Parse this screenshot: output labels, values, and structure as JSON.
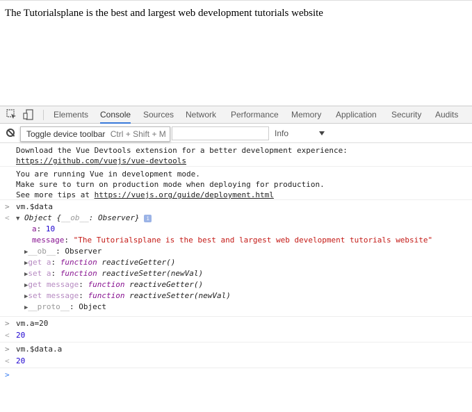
{
  "page": {
    "text": "The Tutorialsplane is the best and largest web development tutorials website"
  },
  "devtools": {
    "tabs": [
      "Elements",
      "Console",
      "Sources",
      "Network",
      "Performance",
      "Memory",
      "Application",
      "Security",
      "Audits"
    ],
    "active_tab": "Console",
    "tooltip": {
      "label": "Toggle device toolbar",
      "shortcut": "Ctrl + Shift + M"
    },
    "filter_placeholder": "",
    "level": "Info",
    "icons": [
      "inspect-icon",
      "device-icon",
      "clear-console-icon",
      "dropdown-arrow-icon"
    ],
    "colors": {
      "active_tab_underline": "#3879d9",
      "string": "#c41a16",
      "number": "#1c00cf",
      "key": "#881391"
    }
  },
  "console": {
    "devtools_msg": {
      "line1": "Download the Vue Devtools extension for a better development experience:",
      "link": "https://github.com/vuejs/vue-devtools"
    },
    "devmode_msg": {
      "line1": "You are running Vue in development mode.",
      "line2": "Make sure to turn on production mode when deploying for production.",
      "line3_prefix": "See more tips at ",
      "link": "https://vuejs.org/guide/deployment.html"
    },
    "cmd1": "vm.$data",
    "obj_header_prefix": "Object {",
    "obj_header_key": "__ob__",
    "obj_header_suffix": ": Observer}",
    "props": {
      "a_key": "a",
      "a_val": "10",
      "msg_key": "message",
      "msg_val": "\"The Tutorialsplane is the best and largest web development tutorials website\"",
      "ob_key": "__ob__",
      "ob_val": ": Observer",
      "get_a_key": "get a",
      "get_a_fn": "function",
      "get_a_name": "reactiveGetter()",
      "set_a_key": "set a",
      "set_a_fn": "function",
      "set_a_name": "reactiveSetter(newVal)",
      "get_msg_key": "get message",
      "get_msg_fn": "function",
      "get_msg_name": "reactiveGetter()",
      "set_msg_key": "set message",
      "set_msg_fn": "function",
      "set_msg_name": "reactiveSetter(newVal)",
      "proto_key": "__proto__",
      "proto_val": ": Object"
    },
    "cmd2": "vm.a=20",
    "res2": "20",
    "cmd3": "vm.$data.a",
    "res3": "20"
  }
}
